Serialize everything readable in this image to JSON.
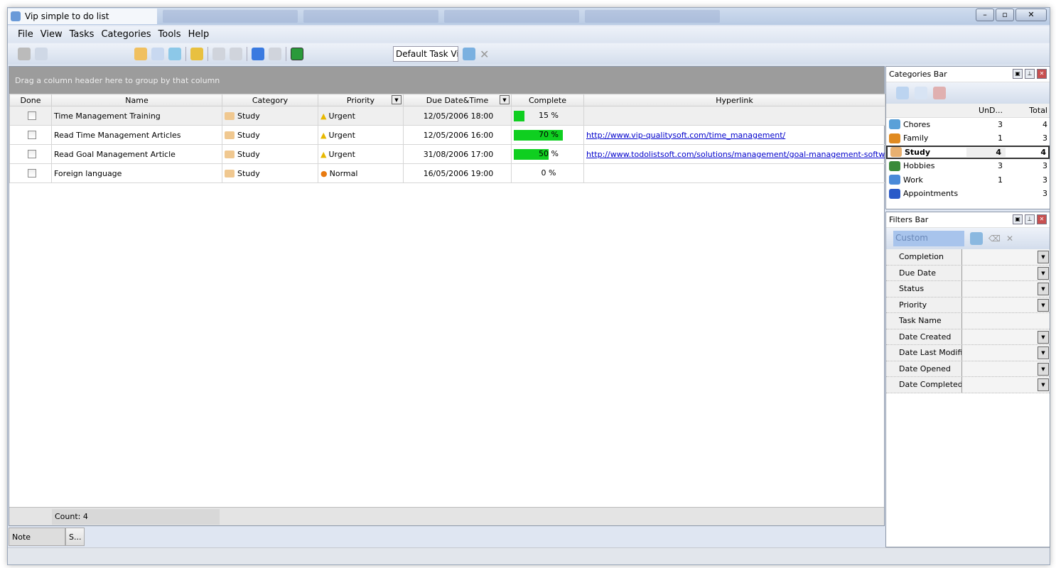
{
  "window": {
    "title": "Vip simple to do list"
  },
  "menu": [
    "File",
    "View",
    "Tasks",
    "Categories",
    "Tools",
    "Help"
  ],
  "toolbar": {
    "view_combo": "Default Task View",
    "icons": [
      "print-icon",
      "print-preview-icon",
      "new-task-icon",
      "edit-task-icon",
      "recycle-icon",
      "handshake-icon",
      "move-down-icon",
      "move-up-icon",
      "move-bottom-icon",
      "move-top-icon",
      "green-flag-icon"
    ]
  },
  "grid": {
    "group_hint": "Drag a column header here to group by that column",
    "columns": [
      "Done",
      "Name",
      "Category",
      "Priority",
      "Due Date&Time",
      "Complete",
      "Hyperlink"
    ],
    "rows": [
      {
        "done": false,
        "name": "Time Management Training",
        "category": "Study",
        "priority": "Urgent",
        "due": "12/05/2006 18:00",
        "complete": 15,
        "complete_label": "15 %",
        "hyperlink": ""
      },
      {
        "done": false,
        "name": "Read Time Management Articles",
        "category": "Study",
        "priority": "Urgent",
        "due": "12/05/2006 16:00",
        "complete": 70,
        "complete_label": "70 %",
        "hyperlink": "http://www.vip-qualitysoft.com/time_management/"
      },
      {
        "done": false,
        "name": "Read Goal Management Article",
        "category": "Study",
        "priority": "Urgent",
        "due": "31/08/2006 17:00",
        "complete": 50,
        "complete_label": "50 %",
        "hyperlink": "http://www.todolistsoft.com/solutions/management/goal-management-software/"
      },
      {
        "done": false,
        "name": "Foreign language",
        "category": "Study",
        "priority": "Normal",
        "due": "16/05/2006 19:00",
        "complete": 0,
        "complete_label": "0 %",
        "hyperlink": ""
      }
    ],
    "count": "Count: 4"
  },
  "bottom_tabs": [
    "Note",
    "S..."
  ],
  "categories_bar": {
    "title": "Categories Bar",
    "col_undone": "UnD...",
    "col_total": "Total",
    "items": [
      {
        "name": "Chores",
        "undone": "3",
        "total": "4",
        "color": "#5aa0d8"
      },
      {
        "name": "Family",
        "undone": "1",
        "total": "3",
        "color": "#e08a20"
      },
      {
        "name": "Study",
        "undone": "4",
        "total": "4",
        "color": "#e8b070",
        "selected": true
      },
      {
        "name": "Hobbies",
        "undone": "3",
        "total": "3",
        "color": "#3a8a3a"
      },
      {
        "name": "Work",
        "undone": "1",
        "total": "3",
        "color": "#4a8ad8"
      },
      {
        "name": "Appointments",
        "undone": "",
        "total": "3",
        "color": "#2a5ac8"
      }
    ]
  },
  "filters_bar": {
    "title": "Filters Bar",
    "preset": "Custom",
    "filters": [
      {
        "label": "Completion",
        "dropdown": true
      },
      {
        "label": "Due Date",
        "dropdown": true
      },
      {
        "label": "Status",
        "dropdown": true
      },
      {
        "label": "Priority",
        "dropdown": true
      },
      {
        "label": "Task Name",
        "dropdown": false
      },
      {
        "label": "Date Created",
        "dropdown": true
      },
      {
        "label": "Date Last Modified",
        "dropdown": true
      },
      {
        "label": "Date Opened",
        "dropdown": true
      },
      {
        "label": "Date Completed",
        "dropdown": true
      }
    ]
  },
  "colors": {
    "progress": "#0fcf20",
    "link": "#0000cc",
    "urgent": "#e8b800",
    "normal": "#e87a10"
  }
}
